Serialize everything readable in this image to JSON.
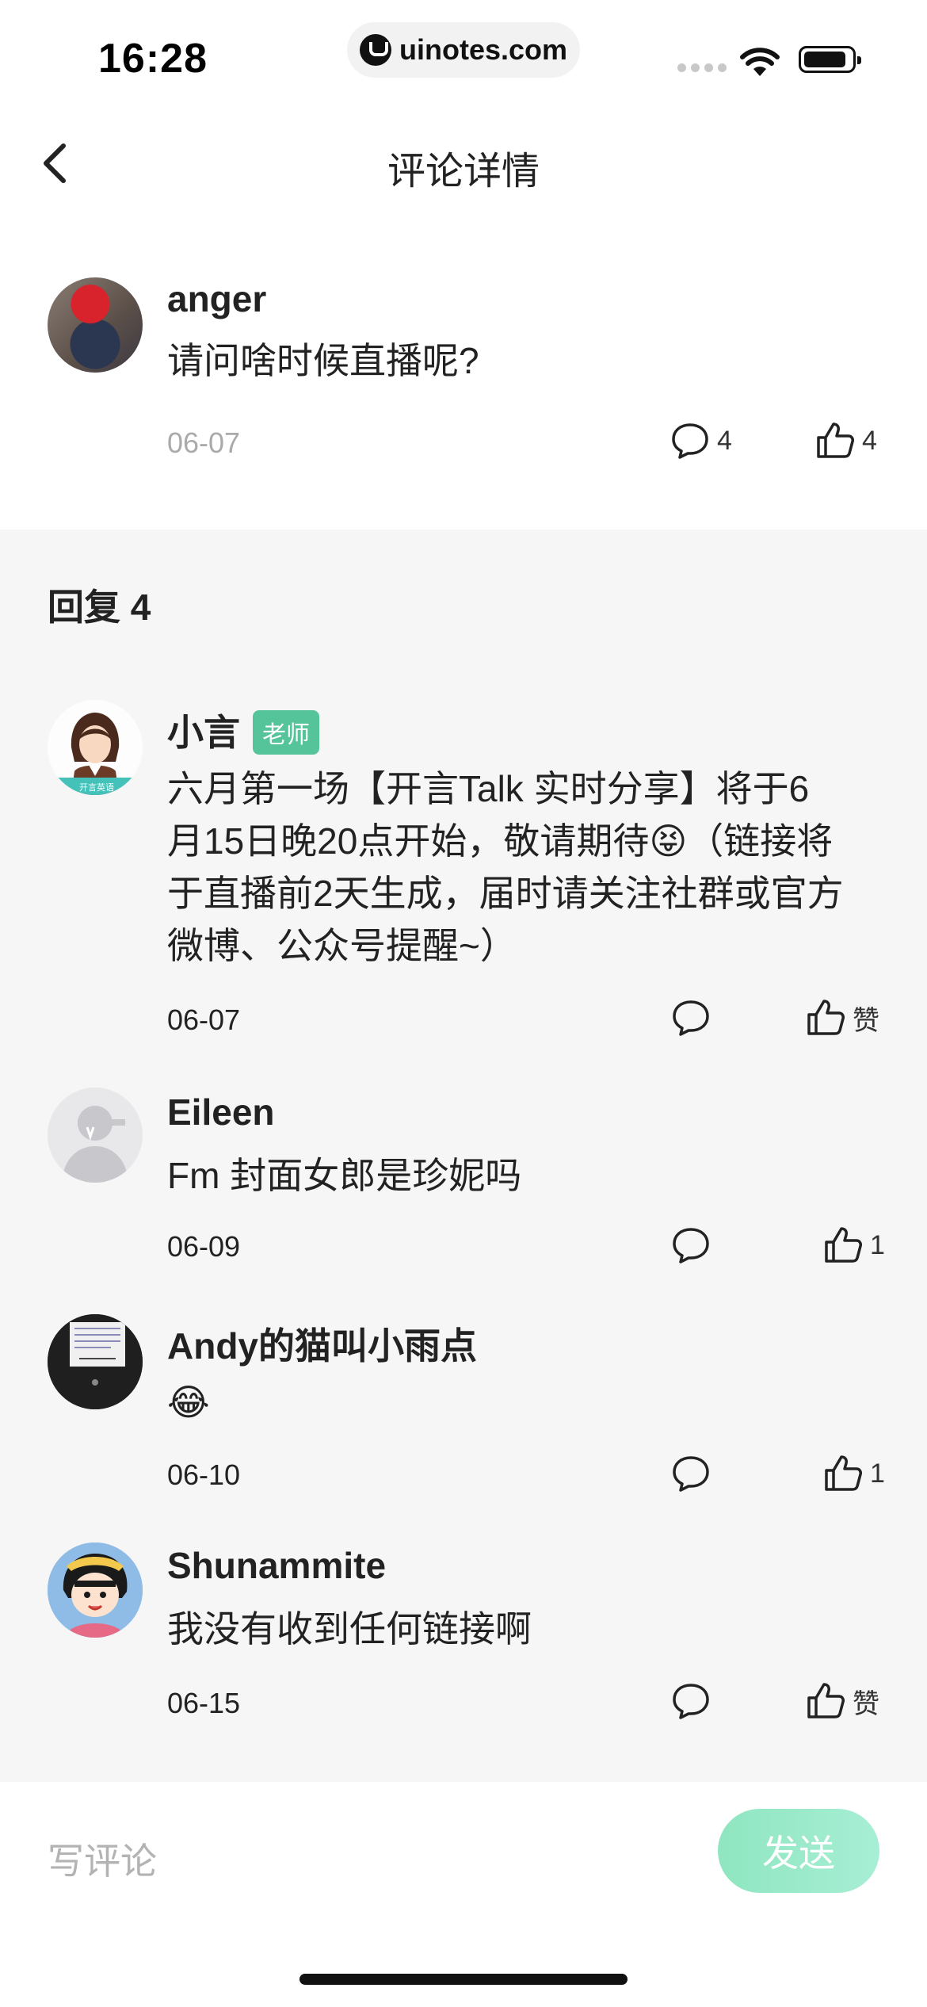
{
  "status_bar": {
    "time": "16:28",
    "url": "uinotes.com"
  },
  "header": {
    "title": "评论详情"
  },
  "main_comment": {
    "author": "anger",
    "text": "请问啥时候直播呢?",
    "date": "06-07",
    "reply_count": "4",
    "like_count": "4"
  },
  "replies_section": {
    "heading": "回复 4"
  },
  "replies": [
    {
      "author": "小言",
      "badge": "老师",
      "lines": [
        "六月第一场【开言Talk 实时分享】将于6",
        "月15日晚20点开始，敬请期待😝（链接将",
        "于直播前2天生成，届时请关注社群或官方",
        "微博、公众号提醒~）"
      ],
      "date": "06-07",
      "like": "赞"
    },
    {
      "author": "Eileen",
      "lines": [
        "Fm 封面女郎是珍妮吗"
      ],
      "date": "06-09",
      "like": "1"
    },
    {
      "author": "Andy的猫叫小雨点",
      "lines": [
        "😂"
      ],
      "date": "06-10",
      "like": "1"
    },
    {
      "author": "Shunammite",
      "lines": [
        "我没有收到任何链接啊"
      ],
      "date": "06-15",
      "like": "赞"
    }
  ],
  "avatar_brand_text": "开言英语",
  "composer": {
    "placeholder": "写评论",
    "send_label": "发送"
  }
}
